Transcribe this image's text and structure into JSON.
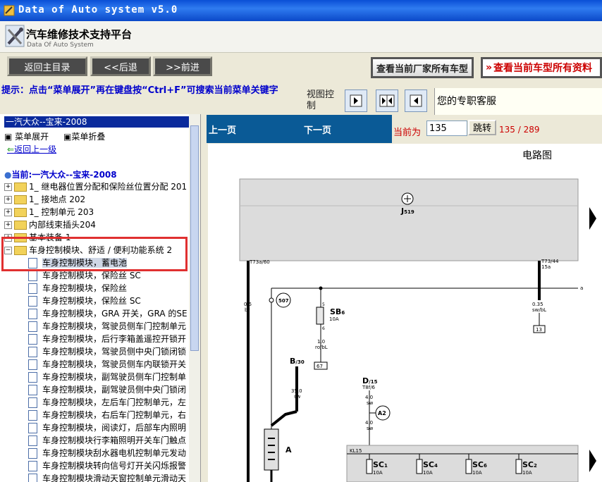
{
  "window": {
    "title": "Data of Auto system v5.0"
  },
  "header": {
    "title_cn": "汽车维修技术支持平台",
    "title_en": "Data Of Auto System"
  },
  "toolbar": {
    "home": "返回主目录",
    "back": "<<后退",
    "forward": ">>前进",
    "all_models": "查看当前厂家所有车型",
    "all_data": "查看当前车型所有资料"
  },
  "hint": "提示：点击“菜单展开”再在键盘按“Ctrl+F”可搜索当前菜单关键字",
  "view_control": {
    "label": "视图控制"
  },
  "service": "您的专职客服",
  "tree": {
    "breadcrumb": "一汽大众--宝来-2008",
    "expand": "菜单展开",
    "collapse": "菜单折叠",
    "back_up": "返回上一级",
    "current": "当前:一汽大众--宝来-2008",
    "folders": [
      "1_ 继电器位置分配和保险丝位置分配 201",
      "1_ 接地点 202",
      "1_ 控制单元 203",
      "内部线束插头204",
      "基本装备 1",
      "车身控制模块、舒适 / 便利功能系统 2"
    ],
    "leaves": [
      "车身控制模块，蓄电池",
      "车身控制模块，保险丝 SC",
      "车身控制模块，保险丝",
      "车身控制模块，保险丝 SC",
      "车身控制模块，GRA 开关，GRA 的SE",
      "车身控制模块，驾驶员侧车门控制单元",
      "车身控制模块，后行李箱盖遥控开锁开",
      "车身控制模块，驾驶员侧中央门锁闭锁",
      "车身控制模块，驾驶员侧车内联锁开关",
      "车身控制模块，副驾驶员侧车门控制单",
      "车身控制模块，副驾驶员侧中央门锁闭",
      "车身控制模块，左后车门控制单元，左",
      "车身控制模块，右后车门控制单元，右",
      "车身控制模块，阅读灯，后部车内照明",
      "车身控制模块行李箱照明开关车门触点",
      "车身控制模块刮水器电机控制单元发动",
      "车身控制模块转向信号灯开关闪烁报警",
      "车身控制模块滑动天窗控制单元滑动天"
    ]
  },
  "pager": {
    "prev": "上一页",
    "next": "下一页",
    "current_label": "当前为",
    "current_value": "135",
    "jump": "跳转",
    "page_info": "135 / 289"
  },
  "diagram": {
    "title": "电路图",
    "labels": {
      "j519": "J",
      "j519_sub": "519",
      "t73a": "T73a/60",
      "t73": "T73/44",
      "pin15a": "15a",
      "w1": "0.5",
      "w1c": "br",
      "w2": "0.35",
      "w2c": "sw/bL",
      "n13": "13",
      "n507": "507",
      "sb": "SB",
      "sb_sub": "6",
      "sb_amp": "10A",
      "pin5": "5",
      "pin6": "6",
      "w3": "1.0",
      "w3c": "ro/bL",
      "n67": "67",
      "b30": "B",
      "b30_sub": "/30",
      "w4": "35.0",
      "w4c": "sw",
      "batt": "A",
      "d15": "D",
      "d15_sub": "/15",
      "t8f": "T8f/6",
      "w5": "4.0",
      "w5c": "sw",
      "a2": "A2",
      "w6": "4.0",
      "w6c": "sw",
      "kl15": "KL15",
      "a": "a",
      "sc1": "SC",
      "sc1_sub": "1",
      "sc4": "SC",
      "sc4_sub": "4",
      "sc6": "SC",
      "sc6_sub": "6",
      "sc2": "SC",
      "sc2_sub": "2",
      "amp": "10A"
    }
  },
  "colors": {
    "accent": "#0a5a96",
    "highlight": "#e03030",
    "hint": "#0000cc"
  }
}
